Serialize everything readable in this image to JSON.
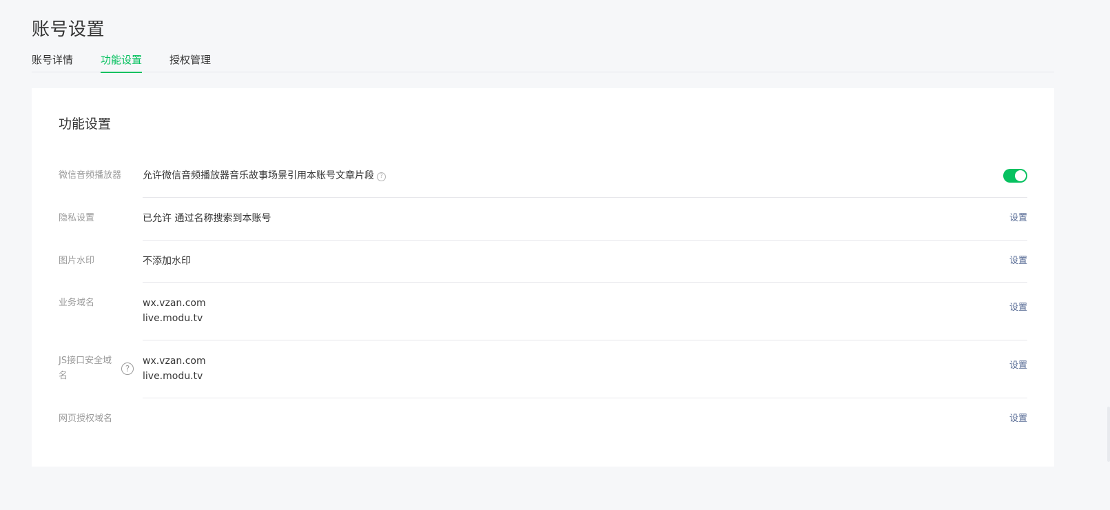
{
  "page": {
    "title": "账号设置",
    "tabs": [
      {
        "label": "账号详情",
        "active": false
      },
      {
        "label": "功能设置",
        "active": true
      },
      {
        "label": "授权管理",
        "active": false
      }
    ]
  },
  "card": {
    "title": "功能设置",
    "rows": [
      {
        "label": "微信音频播放器",
        "value": "允许微信音频播放器音乐故事场景引用本账号文章片段",
        "help_icon": "question-circle-icon",
        "toggle_on": true
      },
      {
        "label": "隐私设置",
        "value": "已允许 通过名称搜索到本账号",
        "action": "设置"
      },
      {
        "label": "图片水印",
        "value": "不添加水印",
        "action": "设置"
      },
      {
        "label": "业务域名",
        "values": [
          "wx.vzan.com",
          "live.modu.tv"
        ],
        "action": "设置"
      },
      {
        "label": "JS接口安全域名",
        "label_lines": [
          "JS接口安全域",
          "名"
        ],
        "help_icon": "question-circle-icon",
        "values": [
          "wx.vzan.com",
          "live.modu.tv"
        ],
        "action": "设置"
      },
      {
        "label": "网页授权域名",
        "action": "设置"
      }
    ]
  },
  "colors": {
    "accent": "#07c160",
    "link": "#576b95",
    "background": "#f6f7f9",
    "card": "#ffffff"
  }
}
